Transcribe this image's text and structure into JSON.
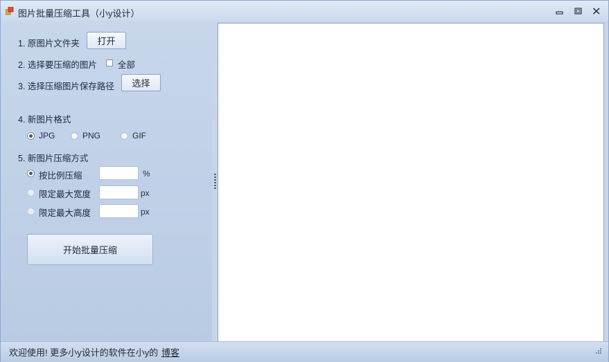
{
  "window": {
    "title": "图片批量压缩工具（小y设计）"
  },
  "steps": {
    "source_folder": {
      "label": "1. 原图片文件夹",
      "button": "打开"
    },
    "select_images": {
      "label": "2. 选择要压缩的图片",
      "checkbox_label": "全部",
      "checked": false
    },
    "save_path": {
      "label": "3. 选择压缩图片保存路径",
      "button": "选择"
    },
    "format": {
      "label": "4. 新图片格式",
      "options": [
        "JPG",
        "PNG",
        "GIF"
      ],
      "selected": "JPG"
    },
    "method": {
      "label": "5. 新图片压缩方式",
      "options": [
        {
          "label": "按比例压缩",
          "value": "",
          "unit": "%",
          "selected": true
        },
        {
          "label": "限定最大宽度",
          "value": "",
          "unit": "px",
          "selected": false
        },
        {
          "label": "限定最大高度",
          "value": "",
          "unit": "px",
          "selected": false
        }
      ]
    }
  },
  "start_button": "开始批量压缩",
  "status": {
    "text": "欢迎使用! 更多小y设计的软件在小y的",
    "link": "博客"
  },
  "colors": {
    "background": "#c6d5ea",
    "canvas": "#ffffff",
    "text": "#1f2a3a"
  }
}
